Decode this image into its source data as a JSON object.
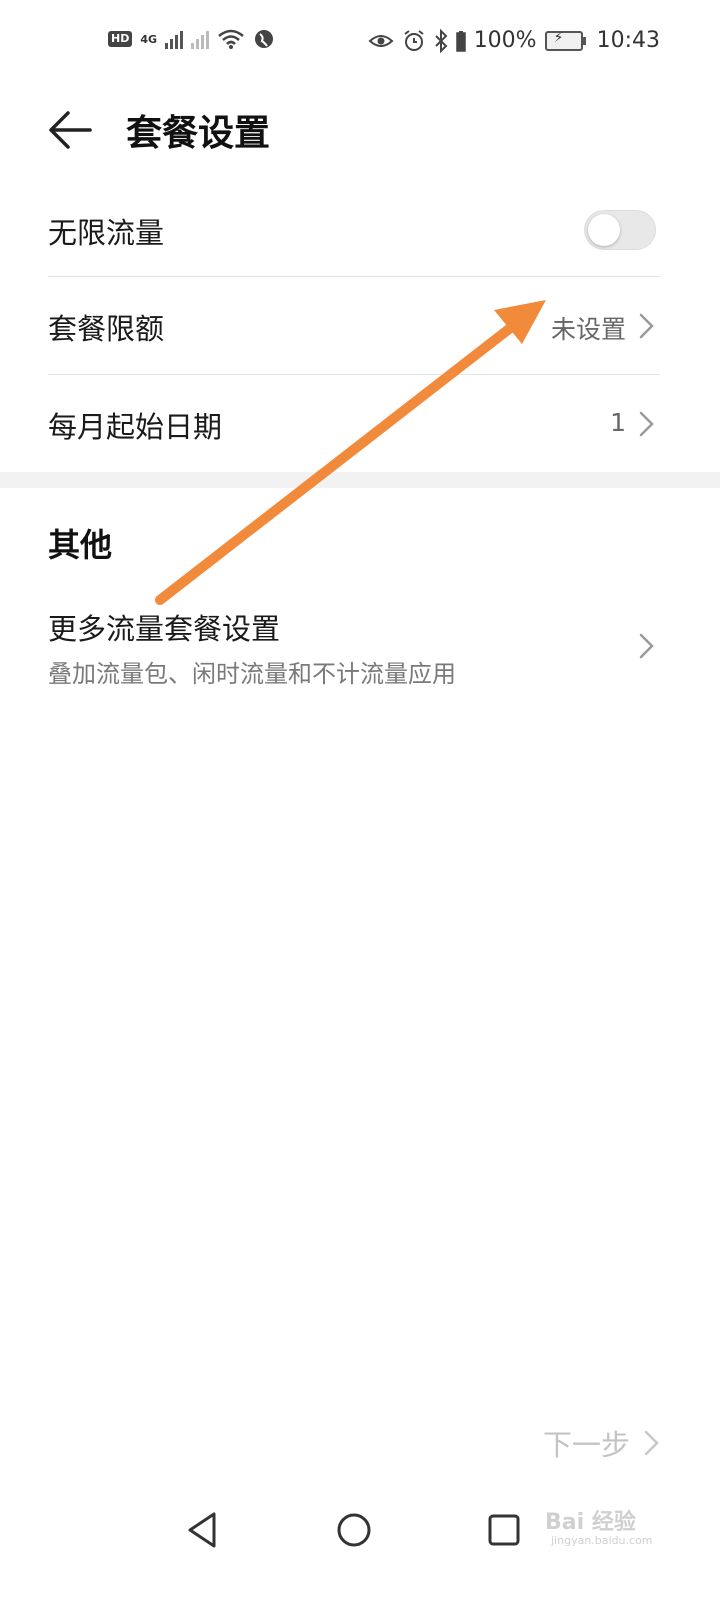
{
  "status_bar": {
    "hd_label": "HD",
    "network_label": "4G",
    "battery_percent": "100%",
    "time": "10:43",
    "icons": [
      "hd-volte-icon",
      "signal-4g-icon",
      "signal-no-sim-icon",
      "wifi-icon",
      "vpn-globe-icon",
      "eye-comfort-icon",
      "alarm-icon",
      "bluetooth-icon",
      "battery-icon",
      "charging-icon"
    ]
  },
  "header": {
    "title": "套餐设置",
    "back_icon": "arrow-left-icon"
  },
  "settings": {
    "unlimited": {
      "label": "无限流量",
      "enabled": false
    },
    "limit": {
      "label": "套餐限额",
      "value": "未设置"
    },
    "start_date": {
      "label": "每月起始日期",
      "value": "1"
    }
  },
  "other": {
    "title": "其他",
    "more": {
      "label": "更多流量套餐设置",
      "description": "叠加流量包、闲时流量和不计流量应用"
    }
  },
  "footer": {
    "next_label": "下一步"
  },
  "nav": {
    "icons": [
      "nav-back-icon",
      "nav-home-icon",
      "nav-recents-icon"
    ]
  },
  "watermark": {
    "text": "Bai 经验",
    "sub": "jingyan.baidu.com"
  },
  "colors": {
    "annotation_arrow": "#f28a3c",
    "divider": "#e3e3e3",
    "toggle_off": "#e8e8e8",
    "secondary_text": "#7a7a7a"
  }
}
